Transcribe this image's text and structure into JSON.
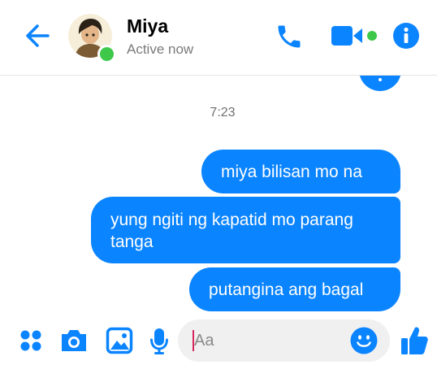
{
  "header": {
    "contact_name": "Miya",
    "status": "Active now"
  },
  "conversation": {
    "timestamp": "7:23",
    "messages": [
      {
        "text": "miya bilisan mo na",
        "sender": "me"
      },
      {
        "text": "yung ngiti ng kapatid mo parang tanga",
        "sender": "me"
      },
      {
        "text": "putangina ang bagal",
        "sender": "me"
      }
    ]
  },
  "composer": {
    "placeholder": "Aa"
  },
  "colors": {
    "accent": "#0b84ff",
    "presence": "#3ec84a"
  },
  "icons": {
    "back": "back-arrow-icon",
    "phone": "phone-icon",
    "video": "video-camera-icon",
    "info": "info-icon",
    "more": "more-apps-icon",
    "camera": "camera-icon",
    "gallery": "gallery-icon",
    "mic": "microphone-icon",
    "emoji": "emoji-icon",
    "like": "thumbs-up-icon"
  }
}
